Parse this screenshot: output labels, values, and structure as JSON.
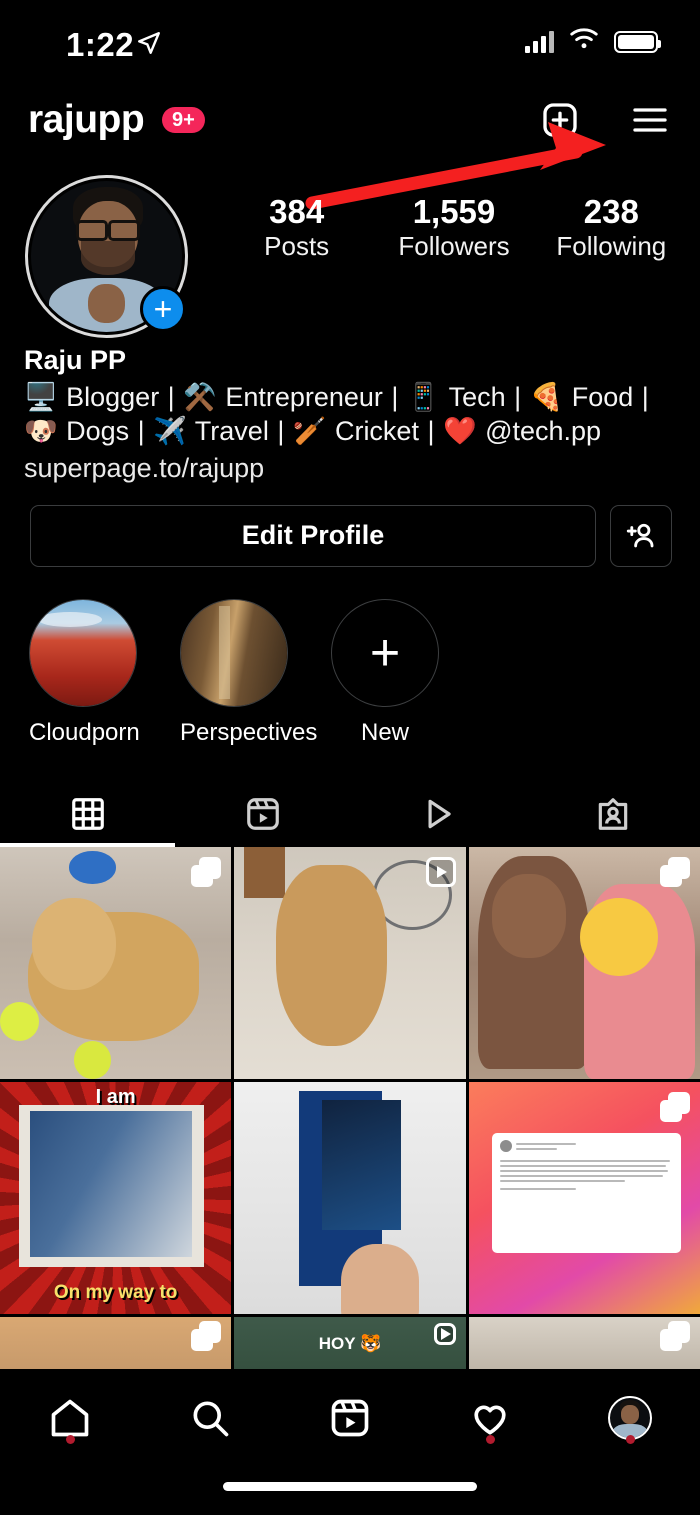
{
  "status_bar": {
    "time": "1:22",
    "location_icon": "location-arrow-icon",
    "signal_icon": "cellular-signal-icon",
    "wifi_icon": "wifi-icon",
    "battery_icon": "battery-full-icon"
  },
  "header": {
    "username": "rajupp",
    "badge": "9+",
    "add_icon": "add-post-icon",
    "menu_icon": "hamburger-menu-icon"
  },
  "annotation": {
    "type": "red-arrow",
    "color": "#f42020",
    "points_to": "hamburger-menu-icon"
  },
  "profile": {
    "avatar_icon": "profile-avatar",
    "add_story_icon": "add-story-plus-icon",
    "stats": [
      {
        "num": "384",
        "label": "Posts"
      },
      {
        "num": "1,559",
        "label": "Followers"
      },
      {
        "num": "238",
        "label": "Following"
      }
    ],
    "full_name": "Raju PP",
    "bio": "🖥️ Blogger | ⚒️ Entrepreneur | 📱 Tech | 🍕 Food | 🐶 Dogs | ✈️ Travel | 🏏 Cricket | ❤️ @tech.pp",
    "link": "superpage.to/rajupp"
  },
  "actions": {
    "edit_profile_label": "Edit Profile",
    "add_user_icon": "add-person-icon"
  },
  "highlights": [
    {
      "label": "Cloudporn",
      "cover": "cloud-field-cover"
    },
    {
      "label": "Perspectives",
      "cover": "wooden-door-cover"
    },
    {
      "label": "New",
      "cover": "plus-icon"
    }
  ],
  "tabs": [
    {
      "name": "grid-tab",
      "icon": "grid-icon",
      "active": true
    },
    {
      "name": "reels-tab",
      "icon": "reels-icon",
      "active": false
    },
    {
      "name": "igtv-tab",
      "icon": "play-triangle-icon",
      "active": false
    },
    {
      "name": "tagged-tab",
      "icon": "tagged-person-icon",
      "active": false
    }
  ],
  "posts": [
    {
      "style": "p-dog1",
      "overlay": "carousel-icon",
      "alt": "golden retriever lying with tennis balls"
    },
    {
      "style": "p-dog2",
      "overlay": "reel-icon",
      "alt": "dog near bicycle indoors"
    },
    {
      "style": "p-selfie",
      "overlay": "carousel-icon",
      "alt": "man with child and emoji sticker"
    },
    {
      "style": "p-meme",
      "overlay": "none",
      "alt": "meme poster",
      "text_top": "I am",
      "text_bottom": "On my way to"
    },
    {
      "style": "p-phone",
      "overlay": "none",
      "alt": "hand holding smartphone box"
    },
    {
      "style": "p-tweet",
      "overlay": "carousel-icon",
      "alt": "tweet screenshot on gradient",
      "tweet_text": "I used to cringe when I looked at Twitter accounts that endlessly tweeted preachy stuff about fitness. I don't want to be one, but I can't hold myself back on this. If you are still not in your 30s (or mid-30s) yet, start taking fitness a little more seriously. (1/5)"
    },
    {
      "style": "p-tan",
      "overlay": "carousel-icon",
      "alt": "tan colored photo"
    },
    {
      "style": "p-green",
      "overlay": "reel-icon",
      "alt": "green video thumbnail",
      "text": "HOY 🐯"
    },
    {
      "style": "p-light",
      "overlay": "carousel-icon",
      "alt": "light colored photo"
    }
  ],
  "bottom_nav": [
    {
      "name": "home",
      "icon": "home-icon",
      "dot": true
    },
    {
      "name": "search",
      "icon": "search-icon",
      "dot": false
    },
    {
      "name": "reels",
      "icon": "reels-icon",
      "dot": false
    },
    {
      "name": "activity",
      "icon": "heart-icon",
      "dot": true
    },
    {
      "name": "profile",
      "icon": "profile-avatar-icon",
      "dot": true
    }
  ]
}
